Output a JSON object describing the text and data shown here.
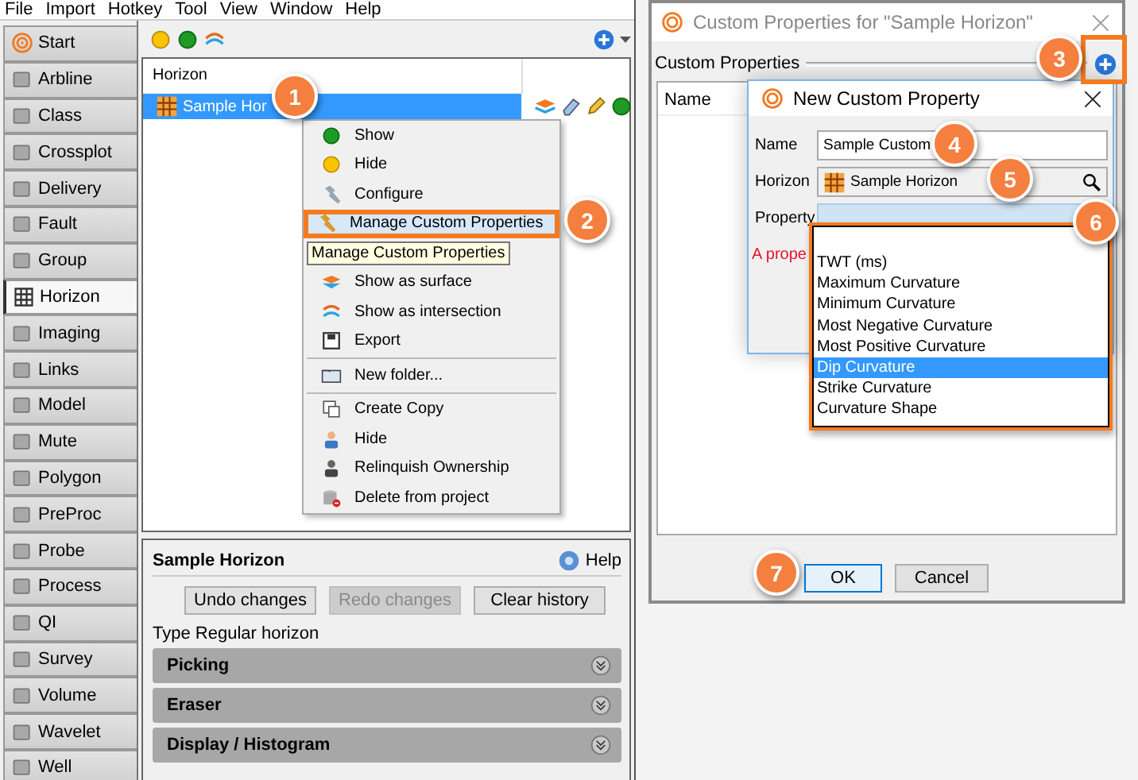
{
  "menu_bar": [
    "File",
    "Import",
    "Hotkey",
    "Tool",
    "View",
    "Window",
    "Help"
  ],
  "side_tabs": [
    {
      "label": "Start",
      "selected": false
    },
    {
      "label": "Arbline",
      "selected": false
    },
    {
      "label": "Class",
      "selected": false
    },
    {
      "label": "Crossplot",
      "selected": false
    },
    {
      "label": "Delivery",
      "selected": false
    },
    {
      "label": "Fault",
      "selected": false
    },
    {
      "label": "Group",
      "selected": false
    },
    {
      "label": "Horizon",
      "selected": true
    },
    {
      "label": "Imaging",
      "selected": false
    },
    {
      "label": "Links",
      "selected": false
    },
    {
      "label": "Model",
      "selected": false
    },
    {
      "label": "Mute",
      "selected": false
    },
    {
      "label": "Polygon",
      "selected": false
    },
    {
      "label": "PreProc",
      "selected": false
    },
    {
      "label": "Probe",
      "selected": false
    },
    {
      "label": "Process",
      "selected": false
    },
    {
      "label": "QI",
      "selected": false
    },
    {
      "label": "Survey",
      "selected": false
    },
    {
      "label": "Volume",
      "selected": false
    },
    {
      "label": "Wavelet",
      "selected": false
    },
    {
      "label": "Well",
      "selected": false
    }
  ],
  "tree": {
    "header": "Horizon",
    "items": [
      {
        "label": "Sample Hor",
        "selected": true
      }
    ]
  },
  "context_menu": {
    "items": [
      {
        "kind": "item",
        "label": "Show",
        "selected": false
      },
      {
        "kind": "item",
        "label": "Hide",
        "selected": false
      },
      {
        "kind": "item",
        "label": "Configure",
        "selected": false
      },
      {
        "kind": "item",
        "label": "Manage Custom Properties",
        "selected": true
      },
      {
        "kind": "tooltip",
        "label": "Manage Custom Properties"
      },
      {
        "kind": "item",
        "label": "Show as surface",
        "selected": false
      },
      {
        "kind": "item",
        "label": "Show as intersection",
        "selected": false
      },
      {
        "kind": "item",
        "label": "Export",
        "selected": false
      },
      {
        "kind": "separator"
      },
      {
        "kind": "item",
        "label": "New folder...",
        "selected": false
      },
      {
        "kind": "separator"
      },
      {
        "kind": "item",
        "label": "Create Copy",
        "selected": false
      },
      {
        "kind": "item",
        "label": "Hide",
        "selected": false
      },
      {
        "kind": "item",
        "label": "Relinquish Ownership",
        "selected": false
      },
      {
        "kind": "item",
        "label": "Delete from project",
        "selected": false
      }
    ]
  },
  "properties_panel": {
    "title": "Sample Horizon",
    "help": "Help",
    "buttons": [
      {
        "label": "Undo changes",
        "disabled": false
      },
      {
        "label": "Redo changes",
        "disabled": true
      },
      {
        "label": "Clear history",
        "disabled": false
      }
    ],
    "type_text": "Type Regular horizon",
    "sections": [
      {
        "label": "Picking",
        "expanded": false
      },
      {
        "label": "Eraser",
        "expanded": false
      },
      {
        "label": "Display / Histogram",
        "expanded": false
      }
    ]
  },
  "dialog": {
    "title": "Custom Properties for \"Sample Horizon\"",
    "group_label": "Custom Properties",
    "table": {
      "columns": [
        "Name"
      ]
    },
    "buttons": [
      {
        "label": "OK",
        "default": true
      },
      {
        "label": "Cancel",
        "default": false
      }
    ]
  },
  "inner_dialog": {
    "title": "New Custom Property",
    "fields": [
      {
        "kind": "text",
        "label": "Name",
        "value": "Sample Custom"
      },
      {
        "kind": "picker",
        "label": "Horizon",
        "value": "Sample Horizon"
      },
      {
        "kind": "combo",
        "label": "Property",
        "focused": true
      }
    ],
    "error_text": "A prope"
  },
  "dropdown": {
    "items": [
      {
        "label": "TWT (ms)",
        "selected": false
      },
      {
        "label": "Maximum Curvature",
        "selected": false
      },
      {
        "label": "Minimum Curvature",
        "selected": false
      },
      {
        "label": "Most Negative Curvature",
        "selected": false
      },
      {
        "label": "Most Positive Curvature",
        "selected": false
      },
      {
        "label": "Dip Curvature",
        "selected": true
      },
      {
        "label": "Strike Curvature",
        "selected": false
      },
      {
        "label": "Curvature Shape",
        "selected": false
      }
    ]
  },
  "callouts": [
    "1",
    "2",
    "3",
    "4",
    "5",
    "6",
    "7"
  ]
}
